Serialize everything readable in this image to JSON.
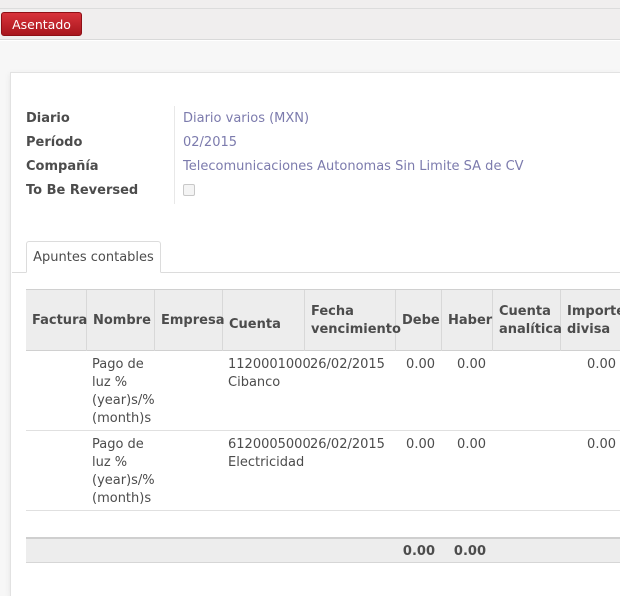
{
  "status": {
    "state_label": "Asentado"
  },
  "form": {
    "journal_label": "Diario",
    "journal_value": "Diario varios (MXN)",
    "period_label": "Período",
    "period_value": "02/2015",
    "company_label": "Compañía",
    "company_value": "Telecomunicaciones Autonomas Sin Limite SA de CV",
    "reversed_label": "To Be Reversed",
    "reversed_checked": false
  },
  "tabs": [
    {
      "label": "Apuntes contables"
    }
  ],
  "table": {
    "headers": {
      "invoice": "Factura",
      "name": "Nombre",
      "partner": "Empresa",
      "account": "Cuenta",
      "due_date_1": "Fecha",
      "due_date_2": "vencimiento",
      "debit": "Debe",
      "credit": "Haber",
      "analytic_1": "Cuenta",
      "analytic_2": "analítica",
      "amount_currency_1": "Importe",
      "amount_currency_2": "divisa"
    },
    "rows": [
      {
        "invoice": "",
        "name_lines": [
          "Pago de",
          "luz %",
          "(year)s/%",
          "(month)s"
        ],
        "partner": "",
        "account_code": "1120001000",
        "account_name": "Cibanco",
        "due_date": "26/02/2015",
        "debit": "0.00",
        "credit": "0.00",
        "analytic": "",
        "amount_currency": "0.00"
      },
      {
        "invoice": "",
        "name_lines": [
          "Pago de",
          "luz %",
          "(year)s/%",
          "(month)s"
        ],
        "partner": "",
        "account_code": "6120005000",
        "account_name": "Electricidad",
        "due_date": "26/02/2015",
        "debit": "0.00",
        "credit": "0.00",
        "analytic": "",
        "amount_currency": "0.00"
      }
    ],
    "totals": {
      "debit": "0.00",
      "credit": "0.00"
    }
  },
  "colors": {
    "accent_red": "#b81d24",
    "link_purple": "#7c7bad",
    "header_bg": "#ededed"
  }
}
